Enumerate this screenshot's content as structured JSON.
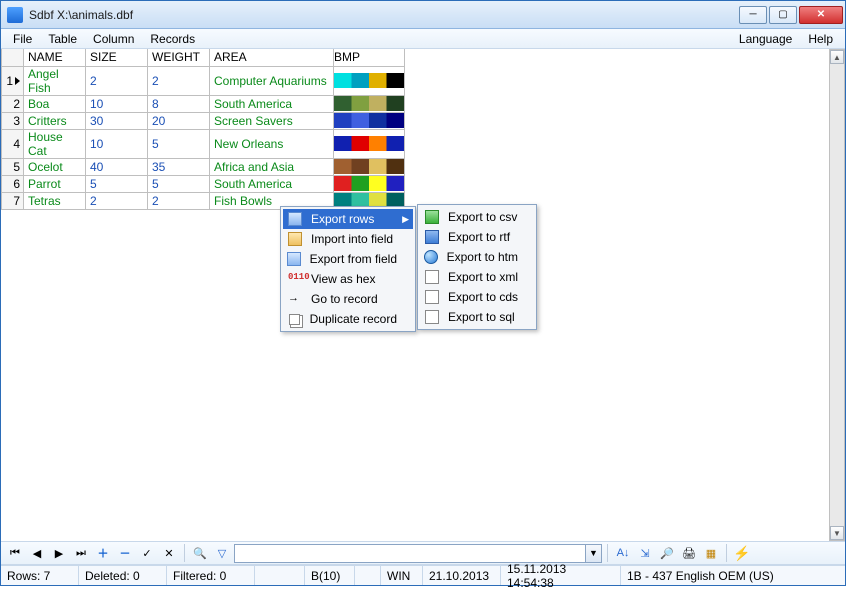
{
  "window": {
    "title": "Sdbf X:\\animals.dbf"
  },
  "menus": {
    "file": "File",
    "table": "Table",
    "column": "Column",
    "records": "Records",
    "language": "Language",
    "help": "Help"
  },
  "columns": [
    "NAME",
    "SIZE",
    "WEIGHT",
    "AREA",
    "BMP"
  ],
  "rows": [
    {
      "n": 1,
      "name": "Angel Fish",
      "size": 2,
      "weight": 2,
      "area": "Computer Aquariums",
      "bmp": [
        "#00e0e0",
        "#00a0c0",
        "#e0b000",
        "#000000"
      ]
    },
    {
      "n": 2,
      "name": "Boa",
      "size": 10,
      "weight": 8,
      "area": "South America",
      "bmp": [
        "#306030",
        "#80a040",
        "#c0b060",
        "#204020"
      ]
    },
    {
      "n": 3,
      "name": "Critters",
      "size": 30,
      "weight": 20,
      "area": "Screen Savers",
      "bmp": [
        "#2040c0",
        "#4060e0",
        "#1030a0",
        "#000080"
      ]
    },
    {
      "n": 4,
      "name": "House Cat",
      "size": 10,
      "weight": 5,
      "area": "New Orleans",
      "bmp": [
        "#1020b0",
        "#e00000",
        "#ff8000",
        "#1020b0"
      ]
    },
    {
      "n": 5,
      "name": "Ocelot",
      "size": 40,
      "weight": 35,
      "area": "Africa and Asia",
      "bmp": [
        "#a06030",
        "#704020",
        "#e0c060",
        "#503010"
      ]
    },
    {
      "n": 6,
      "name": "Parrot",
      "size": 5,
      "weight": 5,
      "area": "South America",
      "bmp": [
        "#e02020",
        "#20a020",
        "#ffff20",
        "#2020c0"
      ]
    },
    {
      "n": 7,
      "name": "Tetras",
      "size": 2,
      "weight": 2,
      "area": "Fish Bowls",
      "bmp": [
        "#008080",
        "#30c0a0",
        "#e0e040",
        "#006060"
      ]
    }
  ],
  "ctx_main": [
    {
      "label": "Export rows",
      "icon": "export",
      "sub": true,
      "selected": true
    },
    {
      "label": "Import into field",
      "icon": "import"
    },
    {
      "label": "Export from field",
      "icon": "export"
    },
    {
      "label": "View as hex",
      "icon": "hex"
    },
    {
      "label": "Go to record",
      "icon": "goto"
    },
    {
      "label": "Duplicate record",
      "icon": "dup"
    }
  ],
  "ctx_sub": [
    {
      "label": "Export to csv",
      "icon": "csv"
    },
    {
      "label": "Export to rtf",
      "icon": "rtf"
    },
    {
      "label": "Export to htm",
      "icon": "htm"
    },
    {
      "label": "Export to xml",
      "icon": "xml"
    },
    {
      "label": "Export to cds",
      "icon": "cds"
    },
    {
      "label": "Export to sql",
      "icon": "sql"
    }
  ],
  "toolbar": {
    "nav": [
      "⏮",
      "◀",
      "▶",
      "⏭"
    ],
    "edit": [
      "＋",
      "－",
      "✓",
      "✕"
    ]
  },
  "status": {
    "rows": "Rows: 7",
    "deleted": "Deleted: 0",
    "filtered": "Filtered: 0",
    "bsize": "B(10)",
    "encoding": "WIN",
    "date": "21.10.2013",
    "datetime": "15.11.2013 14:54:38",
    "codepage": "1B - 437 English OEM (US)"
  }
}
